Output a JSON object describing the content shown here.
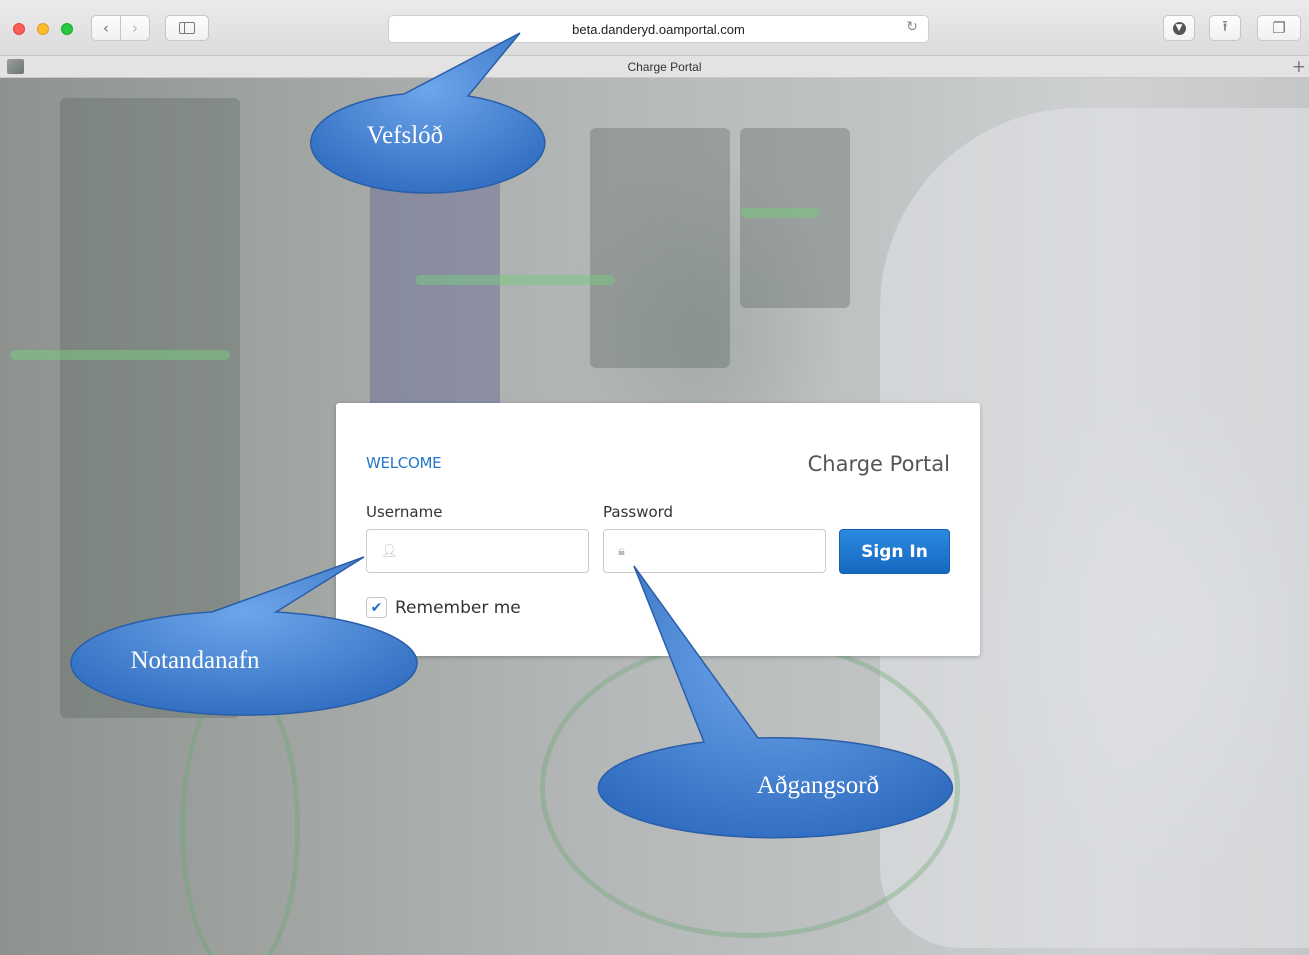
{
  "browser": {
    "url": "beta.danderyd.oamportal.com",
    "tab_title": "Charge Portal",
    "icons": {
      "back": "chevron-left-icon",
      "forward": "chevron-right-icon",
      "sidebar": "sidebar-icon",
      "reload": "reload-icon",
      "download": "download-icon",
      "share": "share-icon",
      "tabs": "tabs-icon",
      "new_tab": "plus-icon"
    }
  },
  "login": {
    "welcome": "WELCOME",
    "brand": "Charge Portal",
    "username_label": "Username",
    "username_value": "",
    "password_label": "Password",
    "password_value": "",
    "sign_in": "Sign In",
    "remember_label": "Remember me",
    "remember_checked": true,
    "accent_color": "#1f78c8"
  },
  "callouts": {
    "url_note": "Vefslóð",
    "username_note": "Notandanafn",
    "password_note": "Aðgangsorð",
    "fill_color": "#3f7fd0"
  }
}
